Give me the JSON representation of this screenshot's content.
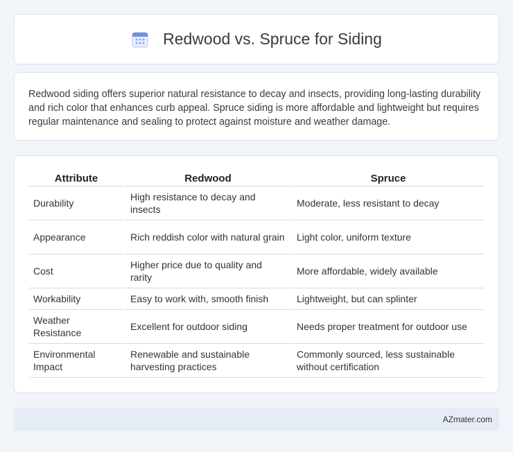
{
  "header": {
    "title": "Redwood vs. Spruce for Siding",
    "icon": "calendar-icon",
    "icon_color": "#6f8fe0"
  },
  "intro": {
    "text": "Redwood siding offers superior natural resistance to decay and insects, providing long-lasting durability and rich color that enhances curb appeal. Spruce siding is more affordable and lightweight but requires regular maintenance and sealing to protect against moisture and weather damage."
  },
  "table": {
    "headers": [
      "Attribute",
      "Redwood",
      "Spruce"
    ],
    "rows": [
      [
        "Durability",
        "High resistance to decay and insects",
        "Moderate, less resistant to decay"
      ],
      [
        "Appearance",
        "Rich reddish color with natural grain",
        "Light color, uniform texture"
      ],
      [
        "Cost",
        "Higher price due to quality and rarity",
        "More affordable, widely available"
      ],
      [
        "Workability",
        "Easy to work with, smooth finish",
        "Lightweight, but can splinter"
      ],
      [
        "Weather Resistance",
        "Excellent for outdoor siding",
        "Needs proper treatment for outdoor use"
      ],
      [
        "Environmental Impact",
        "Renewable and sustainable harvesting practices",
        "Commonly sourced, less sustainable without certification"
      ]
    ]
  },
  "footer": {
    "text": "AZmater.com"
  }
}
